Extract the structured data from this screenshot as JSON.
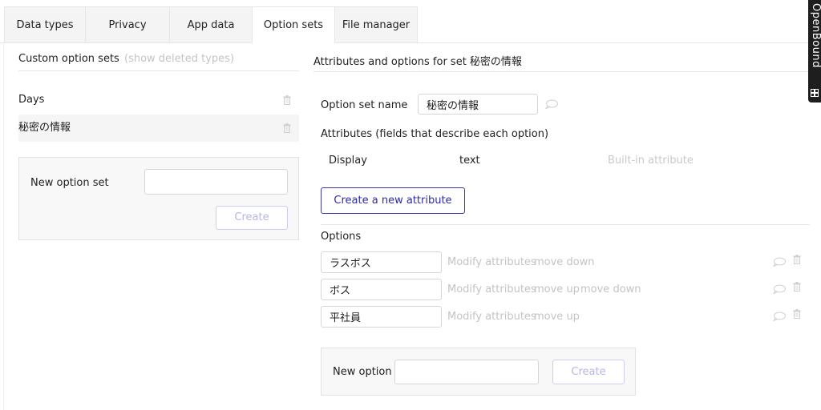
{
  "tabs": [
    {
      "label": "Data types",
      "active": false
    },
    {
      "label": "Privacy",
      "active": false
    },
    {
      "label": "App data",
      "active": false
    },
    {
      "label": "Option sets",
      "active": true
    },
    {
      "label": "File manager",
      "active": false
    }
  ],
  "left": {
    "title": "Custom option sets",
    "show_deleted": "(show deleted types)",
    "sets": [
      "Days",
      "秘密の情報"
    ],
    "new_set_label": "New option set",
    "new_set_value": "",
    "create_label": "Create"
  },
  "right": {
    "title": "Attributes and options for set 秘密の情報",
    "set_name_label": "Option set name",
    "set_name_value": "秘密の情報",
    "attributes_title": "Attributes (fields that describe each option)",
    "attribute": {
      "name": "Display",
      "type": "text",
      "note": "Built-in attribute"
    },
    "create_attribute_label": "Create a new attribute",
    "options_title": "Options",
    "options": [
      {
        "value": "ラスボス",
        "modify": "Modify attributes",
        "actions": [
          "move down"
        ]
      },
      {
        "value": "ボス",
        "modify": "Modify attributes",
        "actions": [
          "move up",
          "move down"
        ]
      },
      {
        "value": "平社員",
        "modify": "Modify attributes",
        "actions": [
          "move up"
        ]
      }
    ],
    "new_option_label": "New option",
    "new_option_value": "",
    "create_label": "Create"
  },
  "side_badge": {
    "label": "OpenBound"
  },
  "colors": {
    "accent": "#2e2c9e",
    "muted": "#c4c4c4",
    "panel": "#f8f8f8"
  }
}
